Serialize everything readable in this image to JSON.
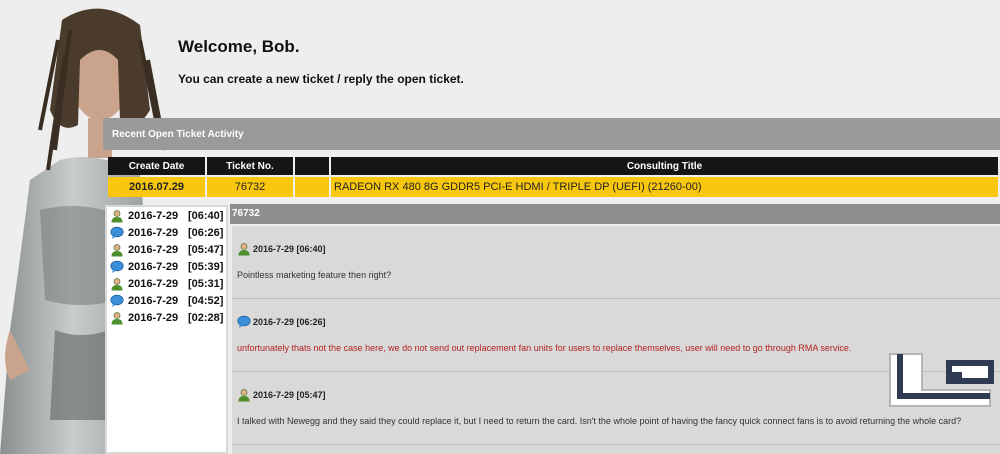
{
  "header": {
    "welcome": "Welcome, Bob.",
    "subtitle": "You can create a new ticket / reply the open ticket."
  },
  "activity": {
    "title": "Recent Open Ticket Activity"
  },
  "ticket_table": {
    "columns": [
      "Create Date",
      "Ticket No.",
      "",
      "Consulting Title"
    ],
    "rows": [
      {
        "create_date": "2016.07.29",
        "ticket_no": "76732",
        "flag": "",
        "title": "RADEON RX 480 8G GDDR5 PCI-E HDMI / TRIPLE DP (UEFI) (21260-00)"
      }
    ]
  },
  "thread": {
    "ticket_no": "76732"
  },
  "sidebar": {
    "items": [
      {
        "icon": "user-icon",
        "date": "2016-7-29",
        "time": "[06:40]"
      },
      {
        "icon": "speech-bubble-icon",
        "date": "2016-7-29",
        "time": "[06:26]"
      },
      {
        "icon": "user-icon",
        "date": "2016-7-29",
        "time": "[05:47]"
      },
      {
        "icon": "speech-bubble-icon",
        "date": "2016-7-29",
        "time": "[05:39]"
      },
      {
        "icon": "user-icon",
        "date": "2016-7-29",
        "time": "[05:31]"
      },
      {
        "icon": "speech-bubble-icon",
        "date": "2016-7-29",
        "time": "[04:52]"
      },
      {
        "icon": "user-icon",
        "date": "2016-7-29",
        "time": "[02:28]"
      }
    ]
  },
  "messages": [
    {
      "icon": "user-icon",
      "stamp": "2016-7-29 [06:40]",
      "text": "Pointless marketing feature then right?"
    },
    {
      "icon": "speech-bubble-icon",
      "stamp": "2016-7-29 [06:26]",
      "text": "unfortunately thats not the case here, we do not send out replacement fan units for users to replace themselves, user will need to go through RMA service."
    },
    {
      "icon": "user-icon",
      "stamp": "2016-7-29 [05:47]",
      "text": "I talked with Newegg and they said they could replace it, but I need to return the card. Isn't the whole point of having the fancy quick connect fans is to avoid returning the whole card?"
    }
  ],
  "colors": {
    "accent": "#f9c80e",
    "header_dark": "#151515",
    "bar_gray": "#9a9a9a",
    "support_text": "#b42121"
  }
}
